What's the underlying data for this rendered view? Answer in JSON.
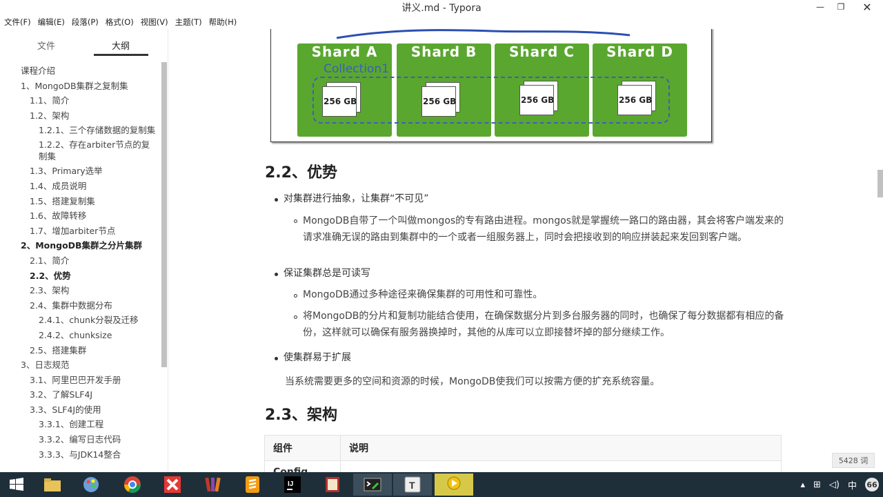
{
  "window": {
    "title": "讲义.md - Typora"
  },
  "menu": [
    "文件(F)",
    "编辑(E)",
    "段落(P)",
    "格式(O)",
    "视图(V)",
    "主题(T)",
    "帮助(H)"
  ],
  "sidebar": {
    "tabs": {
      "files": "文件",
      "outline": "大纲"
    },
    "outline": [
      {
        "label": "课程介绍",
        "level": 1,
        "bold": false
      },
      {
        "label": "1、MongoDB集群之复制集",
        "level": 1,
        "bold": false
      },
      {
        "label": "1.1、简介",
        "level": 2,
        "bold": false
      },
      {
        "label": "1.2、架构",
        "level": 2,
        "bold": false
      },
      {
        "label": "1.2.1、三个存储数据的复制集",
        "level": 3,
        "bold": false
      },
      {
        "label": "1.2.2、存在arbiter节点的复制集",
        "level": 3,
        "bold": false
      },
      {
        "label": "1.3、Primary选举",
        "level": 2,
        "bold": false
      },
      {
        "label": "1.4、成员说明",
        "level": 2,
        "bold": false
      },
      {
        "label": "1.5、搭建复制集",
        "level": 2,
        "bold": false
      },
      {
        "label": "1.6、故障转移",
        "level": 2,
        "bold": false
      },
      {
        "label": "1.7、增加arbiter节点",
        "level": 2,
        "bold": false
      },
      {
        "label": "2、MongoDB集群之分片集群",
        "level": 1,
        "bold": true
      },
      {
        "label": "2.1、简介",
        "level": 2,
        "bold": false
      },
      {
        "label": "2.2、优势",
        "level": 2,
        "bold": true
      },
      {
        "label": "2.3、架构",
        "level": 2,
        "bold": false
      },
      {
        "label": "2.4、集群中数据分布",
        "level": 2,
        "bold": false
      },
      {
        "label": "2.4.1、chunk分裂及迁移",
        "level": 3,
        "bold": false
      },
      {
        "label": "2.4.2、chunksize",
        "level": 3,
        "bold": false
      },
      {
        "label": "2.5、搭建集群",
        "level": 2,
        "bold": false
      },
      {
        "label": "3、日志规范",
        "level": 1,
        "bold": false
      },
      {
        "label": "3.1、阿里巴巴开发手册",
        "level": 2,
        "bold": false
      },
      {
        "label": "3.2、了解SLF4J",
        "level": 2,
        "bold": false
      },
      {
        "label": "3.3、SLF4J的使用",
        "level": 2,
        "bold": false
      },
      {
        "label": "3.3.1、创建工程",
        "level": 3,
        "bold": false
      },
      {
        "label": "3.3.2、编写日志代码",
        "level": 3,
        "bold": false
      },
      {
        "label": "3.3.3、与JDK14整合",
        "level": 3,
        "bold": false
      }
    ],
    "footer": {
      "back": "‹",
      "code": "</>"
    }
  },
  "figure": {
    "shards": [
      "Shard A",
      "Shard B",
      "Shard C",
      "Shard D"
    ],
    "collection": "Collection1",
    "disk_label": "256 GB"
  },
  "section_22": {
    "heading": "2.2、优势",
    "b1": "对集群进行抽象，让集群“不可见”",
    "b1_sub1": "MongoDB自带了一个叫做mongos的专有路由进程。mongos就是掌握统一路口的路由器，其会将客户端发来的请求准确无误的路由到集群中的一个或者一组服务器上，同时会把接收到的响应拼装起来发回到客户端。",
    "b2": "保证集群总是可读写",
    "b2_sub1": "MongoDB通过多种途径来确保集群的可用性和可靠性。",
    "b2_sub2": "将MongoDB的分片和复制功能结合使用，在确保数据分片到多台服务器的同时，也确保了每分数据都有相应的备份，这样就可以确保有服务器换掉时，其他的从库可以立即接替坏掉的部分继续工作。",
    "b3": "使集群易于扩展",
    "b3_para": "当系统需要更多的空间和资源的时候，MongoDB使我们可以按需方便的扩充系统容量。"
  },
  "section_23": {
    "heading": "2.3、架构",
    "table_headers": [
      "组件",
      "说明"
    ],
    "row1_col1": "Config"
  },
  "status": {
    "word_count": "5428 词"
  },
  "taskbar": {
    "tray_ime": "中",
    "tray_badge": "66"
  }
}
